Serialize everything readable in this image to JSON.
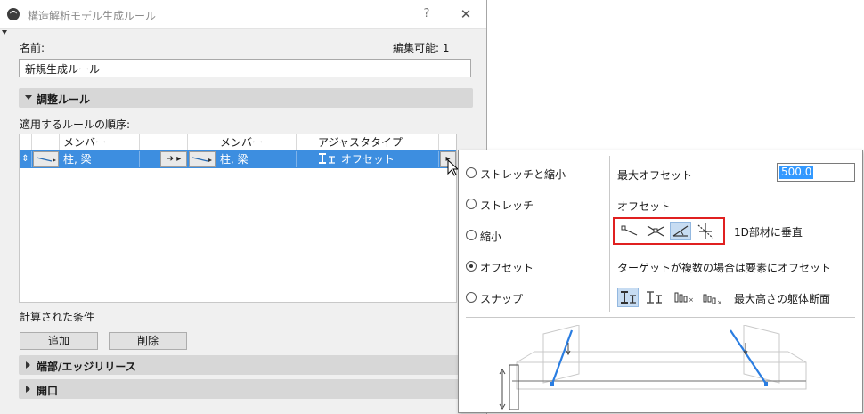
{
  "window": {
    "title": "構造解析モデル生成ルール",
    "help": "?",
    "close": "✕"
  },
  "form": {
    "name_label": "名前:",
    "editable_label": "編集可能: 1",
    "name_value": "新規生成ルール"
  },
  "sections": {
    "adjust": "調整ルール",
    "edge": "端部/エッジリリース",
    "opening": "開口"
  },
  "rules": {
    "order_label": "適用するルールの順序:",
    "columns": [
      "メンバー",
      "メンバー",
      "アジャスタタイプ"
    ],
    "row": {
      "sort": "⇕",
      "member_a": "柱, 梁",
      "arrow": "➔ ▸",
      "member_b": "柱, 梁",
      "adjust_type": "オフセット",
      "menu": "▸"
    }
  },
  "conditions": {
    "label": "計算された条件",
    "add": "追加",
    "delete": "削除"
  },
  "popup": {
    "radios": [
      "ストレッチと縮小",
      "ストレッチ",
      "縮小",
      "オフセット",
      "スナップ"
    ],
    "selected_radio": "オフセット",
    "max_offset_label": "最大オフセット",
    "max_offset_value": "500.0",
    "offset_label": "オフセット",
    "perpendicular_label": "1D部材に垂直",
    "multi_target_label": "ターゲットが複数の場合は要素にオフセット",
    "max_height_label": "最大高さの躯体断面"
  },
  "colors": {
    "selection": "#3d8ee0",
    "highlight_border": "#e02020",
    "diagram_line": "#2a7de1"
  }
}
